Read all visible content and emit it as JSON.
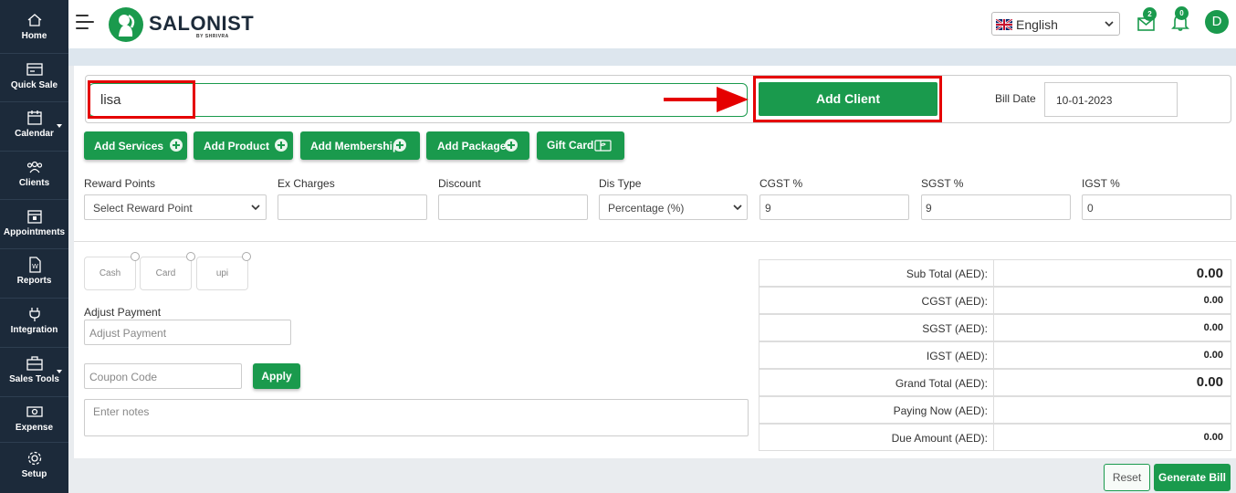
{
  "sidebar": {
    "items": [
      {
        "label": "Home",
        "icon": "home-icon"
      },
      {
        "label": "Quick Sale",
        "icon": "quick-sale-icon"
      },
      {
        "label": "Calendar",
        "icon": "calendar-icon"
      },
      {
        "label": "Clients",
        "icon": "clients-icon"
      },
      {
        "label": "Appointments",
        "icon": "appointments-icon"
      },
      {
        "label": "Reports",
        "icon": "reports-icon"
      },
      {
        "label": "Integration",
        "icon": "plug-icon"
      },
      {
        "label": "Sales Tools",
        "icon": "briefcase-icon"
      },
      {
        "label": "Expense",
        "icon": "cash-icon"
      },
      {
        "label": "Setup",
        "icon": "gear-icon"
      }
    ]
  },
  "header": {
    "brand": "SALONIST",
    "brand_sub": "BY SHRIVRA",
    "language": "English",
    "mail_count": "2",
    "notification_count": "0",
    "avatar_initial": "D"
  },
  "client": {
    "search_value": "lisa",
    "add_client_label": "Add Client",
    "bill_date_label": "Bill Date",
    "bill_date_value": "10-01-2023"
  },
  "actions": {
    "add_services": "Add Services",
    "add_product": "Add Product",
    "add_membership": "Add Membership",
    "add_package": "Add Package",
    "gift_card": "Gift Card"
  },
  "fields": {
    "reward_points_label": "Reward Points",
    "reward_points_value": "Select Reward Point",
    "ex_charges_label": "Ex Charges",
    "discount_label": "Discount",
    "dis_type_label": "Dis Type",
    "dis_type_value": "Percentage (%)",
    "cgst_label": "CGST %",
    "cgst_value": "9",
    "sgst_label": "SGST %",
    "sgst_value": "9",
    "igst_label": "IGST %",
    "igst_value": "0"
  },
  "payment": {
    "methods": [
      "Cash",
      "Card",
      "upi"
    ],
    "adjust_label": "Adjust Payment",
    "adjust_placeholder": "Adjust Payment",
    "coupon_placeholder": "Coupon Code",
    "apply_label": "Apply",
    "notes_placeholder": "Enter notes"
  },
  "summary": [
    {
      "label": "Sub Total (AED):",
      "value": "0.00"
    },
    {
      "label": "CGST (AED):",
      "value": "0.00"
    },
    {
      "label": "SGST (AED):",
      "value": "0.00"
    },
    {
      "label": "IGST (AED):",
      "value": "0.00"
    },
    {
      "label": "Grand Total (AED):",
      "value": "0.00"
    },
    {
      "label": "Paying Now (AED):",
      "value": ""
    },
    {
      "label": "Due Amount (AED):",
      "value": "0.00"
    }
  ],
  "footer": {
    "reset_label": "Reset",
    "generate_label": "Generate Bill"
  },
  "colors": {
    "sidebar": "#1c2a3a",
    "accent_green": "#1a9a4d",
    "highlight_red": "#e50000"
  }
}
